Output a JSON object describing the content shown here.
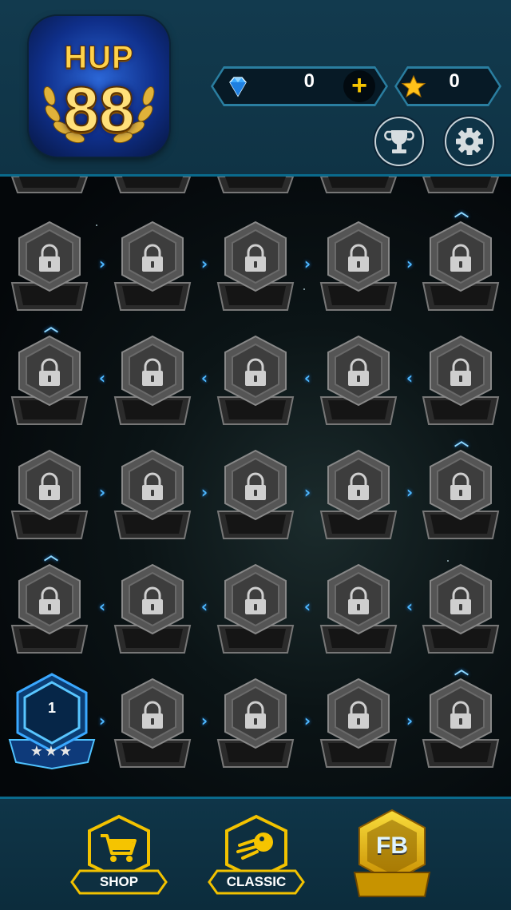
{
  "logo": {
    "line1": "HUP",
    "line2": "88"
  },
  "currency": {
    "gems": "0",
    "add_symbol": "+",
    "stars": "0"
  },
  "level_one": {
    "number": "1",
    "stars": "★★★"
  },
  "arrows": {
    "right": "›",
    "left": "‹",
    "up": "︿"
  },
  "nav": {
    "shop": "SHOP",
    "classic": "CLASSIC",
    "fb": "FB"
  },
  "colors": {
    "accent_blue": "#2fa8ff",
    "gold": "#f5c400",
    "locked_grey": "#4a4a4a"
  }
}
